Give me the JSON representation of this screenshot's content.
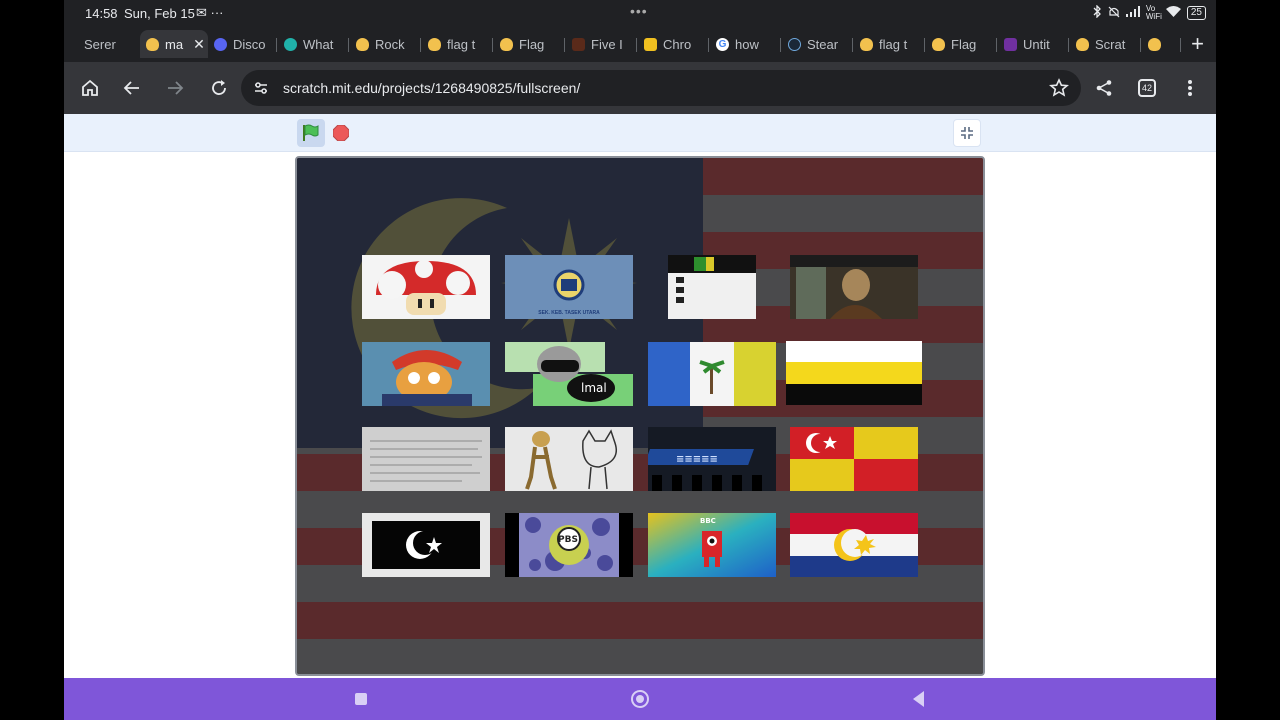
{
  "status_bar": {
    "time": "14:58",
    "date": "Sun, Feb 15",
    "extra": "✉ ···",
    "center_dots": "•••",
    "signal_label": "Vo WiFi",
    "battery": "25"
  },
  "tabs": [
    {
      "title": "Serer",
      "favicon": "scratch"
    },
    {
      "title": "ma",
      "favicon": "scratch",
      "active": true
    },
    {
      "title": "Disco",
      "favicon": "discord"
    },
    {
      "title": "What",
      "favicon": "whatsapp"
    },
    {
      "title": "Rock",
      "favicon": "scratch"
    },
    {
      "title": "flag t",
      "favicon": "scratch"
    },
    {
      "title": "Flag",
      "favicon": "scratch"
    },
    {
      "title": "Five I",
      "favicon": "fnaf"
    },
    {
      "title": "Chro",
      "favicon": "chro"
    },
    {
      "title": "how",
      "favicon": "google"
    },
    {
      "title": "Stear",
      "favicon": "steam"
    },
    {
      "title": "flag t",
      "favicon": "scratch"
    },
    {
      "title": "Flag",
      "favicon": "scratch"
    },
    {
      "title": "Untit",
      "favicon": "untitled"
    },
    {
      "title": "Scrat",
      "favicon": "scratch"
    },
    {
      "title": "",
      "favicon": "scratch"
    }
  ],
  "toolbar": {
    "url": "scratch.mit.edu/projects/1268490825/fullscreen/",
    "tab_count": "42"
  },
  "player": {
    "stage_thumbnails": [
      {
        "id": "mushroom",
        "caption": ""
      },
      {
        "id": "school-emblem",
        "caption": "SEK. KEB. TASEK UTARA"
      },
      {
        "id": "screenshot",
        "caption": ""
      },
      {
        "id": "painting",
        "caption": ""
      },
      {
        "id": "cartoon-dog",
        "caption": ""
      },
      {
        "id": "face-blob",
        "caption": "lmal"
      },
      {
        "id": "penang-flag",
        "caption": ""
      },
      {
        "id": "perak-flag",
        "caption": ""
      },
      {
        "id": "notes-paper",
        "caption": ""
      },
      {
        "id": "sketch-characters",
        "caption": ""
      },
      {
        "id": "game-logo",
        "caption": ""
      },
      {
        "id": "selangor-flag",
        "caption": ""
      },
      {
        "id": "terengganu-flag",
        "caption": ""
      },
      {
        "id": "pbs-logo",
        "caption": "PBS"
      },
      {
        "id": "robot-channel",
        "caption": "BBC"
      },
      {
        "id": "malacca-flag",
        "caption": ""
      }
    ]
  },
  "colors": {
    "chrome_dark": "#202124",
    "toolbar": "#35363a",
    "scratch_bar": "#e9f1fc",
    "nav_bar": "#7f56d9",
    "stripe_red": "#5a2a2c",
    "stripe_white": "#4a4a4c"
  }
}
